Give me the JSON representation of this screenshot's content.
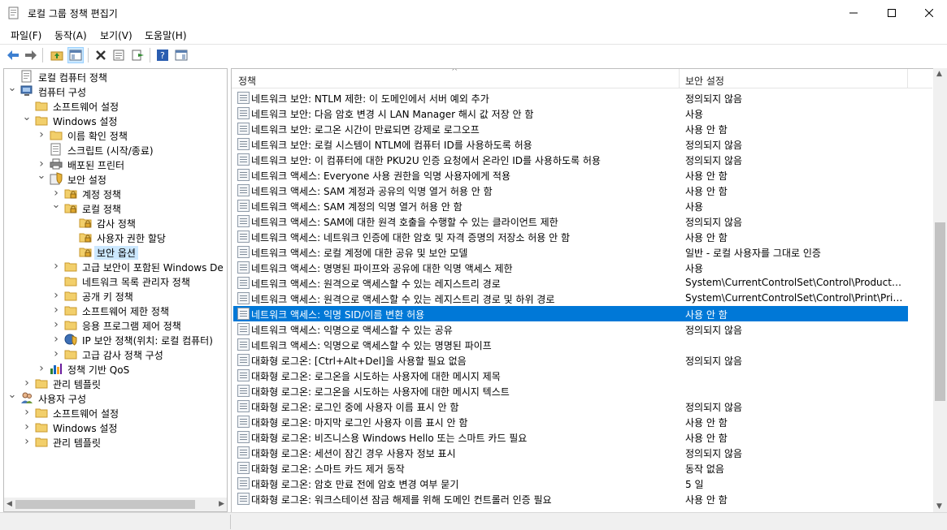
{
  "window": {
    "title": "로컬 그룹 정책 편집기"
  },
  "menu": [
    "파일(F)",
    "동작(A)",
    "보기(V)",
    "도움말(H)"
  ],
  "toolbar_icons": [
    "back-icon",
    "forward-icon",
    "up-folder-icon",
    "show-hide-tree-icon",
    "delete-icon",
    "properties-icon",
    "export-list-icon",
    "help-icon",
    "console-icon"
  ],
  "tree": [
    {
      "label": "로컬 컴퓨터 정책",
      "level": 0,
      "twisty": "",
      "icon": "policy-doc-icon"
    },
    {
      "label": "컴퓨터 구성",
      "level": 0,
      "twisty": "v",
      "icon": "computer-icon"
    },
    {
      "label": "소프트웨어 설정",
      "level": 1,
      "twisty": "",
      "icon": "folder-icon"
    },
    {
      "label": "Windows 설정",
      "level": 1,
      "twisty": "v",
      "icon": "folder-icon"
    },
    {
      "label": "이름 확인 정책",
      "level": 2,
      "twisty": ">",
      "icon": "folder-icon"
    },
    {
      "label": "스크립트 (시작/종료)",
      "level": 2,
      "twisty": "",
      "icon": "script-icon"
    },
    {
      "label": "배포된 프린터",
      "level": 2,
      "twisty": ">",
      "icon": "printer-icon"
    },
    {
      "label": "보안 설정",
      "level": 2,
      "twisty": "v",
      "icon": "security-icon"
    },
    {
      "label": "계정 정책",
      "level": 3,
      "twisty": ">",
      "icon": "folder-icon"
    },
    {
      "label": "로컬 정책",
      "level": 3,
      "twisty": "v",
      "icon": "folder-icon"
    },
    {
      "label": "감사 정책",
      "level": 4,
      "twisty": "",
      "icon": "folder-icon"
    },
    {
      "label": "사용자 권한 할당",
      "level": 4,
      "twisty": "",
      "icon": "folder-icon"
    },
    {
      "label": "보안 옵션",
      "level": 4,
      "twisty": "",
      "icon": "folder-icon",
      "selected": true
    },
    {
      "label": "고급 보안이 포함된 Windows De",
      "level": 3,
      "twisty": ">",
      "icon": "folder-icon"
    },
    {
      "label": "네트워크 목록 관리자 정책",
      "level": 3,
      "twisty": "",
      "icon": "folder-icon"
    },
    {
      "label": "공개 키 정책",
      "level": 3,
      "twisty": ">",
      "icon": "folder-icon"
    },
    {
      "label": "소프트웨어 제한 정책",
      "level": 3,
      "twisty": ">",
      "icon": "folder-icon"
    },
    {
      "label": "응용 프로그램 제어 정책",
      "level": 3,
      "twisty": ">",
      "icon": "folder-icon"
    },
    {
      "label": "IP 보안 정책(위치: 로컬 컴퓨터)",
      "level": 3,
      "twisty": ">",
      "icon": "ip-security-icon"
    },
    {
      "label": "고급 감사 정책 구성",
      "level": 3,
      "twisty": ">",
      "icon": "folder-icon"
    },
    {
      "label": "정책 기반 QoS",
      "level": 2,
      "twisty": ">",
      "icon": "chart-icon"
    },
    {
      "label": "관리 템플릿",
      "level": 1,
      "twisty": ">",
      "icon": "folder-icon"
    },
    {
      "label": "사용자 구성",
      "level": 0,
      "twisty": "v",
      "icon": "user-icon"
    },
    {
      "label": "소프트웨어 설정",
      "level": 1,
      "twisty": ">",
      "icon": "folder-icon"
    },
    {
      "label": "Windows 설정",
      "level": 1,
      "twisty": ">",
      "icon": "folder-icon"
    },
    {
      "label": "관리 템플릿",
      "level": 1,
      "twisty": ">",
      "icon": "folder-icon"
    }
  ],
  "list": {
    "col_policy": "정책",
    "col_setting": "보안 설정",
    "rows": [
      {
        "policy": "네트워크 보안: NTLM 제한: 이 도메인에서 서버 예외 추가",
        "setting": "정의되지 않음"
      },
      {
        "policy": "네트워크 보안: 다음 암호 변경 시 LAN Manager 해시 값 저장 안 함",
        "setting": "사용"
      },
      {
        "policy": "네트워크 보안: 로그온 시간이 만료되면 강제로 로그오프",
        "setting": "사용 안 함"
      },
      {
        "policy": "네트워크 보안: 로컬 시스템이 NTLM에 컴퓨터 ID를 사용하도록 허용",
        "setting": "정의되지 않음"
      },
      {
        "policy": "네트워크 보안: 이 컴퓨터에 대한 PKU2U 인증 요청에서 온라인 ID를 사용하도록 허용",
        "setting": "정의되지 않음"
      },
      {
        "policy": "네트워크 액세스: Everyone 사용 권한을 익명 사용자에게 적용",
        "setting": "사용 안 함"
      },
      {
        "policy": "네트워크 액세스: SAM 계정과 공유의 익명 열거 허용 안 함",
        "setting": "사용 안 함"
      },
      {
        "policy": "네트워크 액세스: SAM 계정의 익명 열거 허용 안 함",
        "setting": "사용"
      },
      {
        "policy": "네트워크 액세스: SAM에 대한 원격 호출을 수행할 수 있는 클라이언트 제한",
        "setting": "정의되지 않음"
      },
      {
        "policy": "네트워크 액세스: 네트워크 인증에 대한 암호 및 자격 증명의 저장소 허용 안 함",
        "setting": "사용 안 함"
      },
      {
        "policy": "네트워크 액세스: 로컬 계정에 대한 공유 및 보안 모델",
        "setting": "일반 - 로컬 사용자를 그대로 인증"
      },
      {
        "policy": "네트워크 액세스: 명명된 파이프와 공유에 대한 익명 액세스 제한",
        "setting": "사용"
      },
      {
        "policy": "네트워크 액세스: 원격으로 액세스할 수 있는 레지스트리 경로",
        "setting": "System\\CurrentControlSet\\Control\\ProductO..."
      },
      {
        "policy": "네트워크 액세스: 원격으로 액세스할 수 있는 레지스트리 경로 및 하위 경로",
        "setting": "System\\CurrentControlSet\\Control\\Print\\Prin..."
      },
      {
        "policy": "네트워크 액세스: 익명 SID/이름 변환 허용",
        "setting": "사용 안 함",
        "selected": true
      },
      {
        "policy": "네트워크 액세스: 익명으로 액세스할 수 있는 공유",
        "setting": "정의되지 않음"
      },
      {
        "policy": "네트워크 액세스: 익명으로 액세스할 수 있는 명명된 파이프",
        "setting": ""
      },
      {
        "policy": "대화형 로그온: [Ctrl+Alt+Del]을 사용할 필요 없음",
        "setting": "정의되지 않음"
      },
      {
        "policy": "대화형 로그온: 로그온을 시도하는 사용자에 대한 메시지 제목",
        "setting": ""
      },
      {
        "policy": "대화형 로그온: 로그온을 시도하는 사용자에 대한 메시지 텍스트",
        "setting": ""
      },
      {
        "policy": "대화형 로그온: 로그인 중에 사용자 이름 표시 안 함",
        "setting": "정의되지 않음"
      },
      {
        "policy": "대화형 로그온: 마지막 로그인 사용자 이름 표시 안 함",
        "setting": "사용 안 함"
      },
      {
        "policy": "대화형 로그온: 비즈니스용 Windows Hello 또는 스마트 카드 필요",
        "setting": "사용 안 함"
      },
      {
        "policy": "대화형 로그온: 세션이 잠긴 경우 사용자 정보 표시",
        "setting": "정의되지 않음"
      },
      {
        "policy": "대화형 로그온: 스마트 카드 제거 동작",
        "setting": "동작 없음"
      },
      {
        "policy": "대화형 로그온: 암호 만료 전에 암호 변경 여부 묻기",
        "setting": "5 일"
      },
      {
        "policy": "대화형 로그온: 워크스테이션 잠금 해제를 위해 도메인 컨트롤러 인증 필요",
        "setting": "사용 안 함"
      }
    ]
  }
}
